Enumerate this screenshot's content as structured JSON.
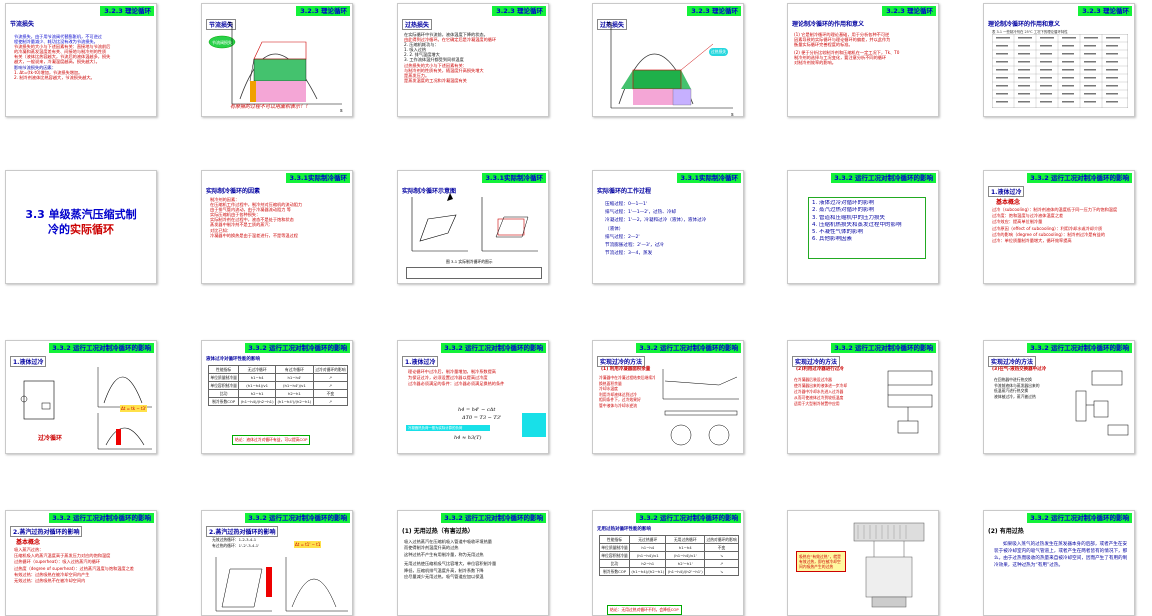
{
  "tiles": [
    {
      "id": 1,
      "header": "3.2.3 理论循环",
      "title": "节流损失",
      "lines": [
        "节流损失，由于用节流阀代替膨胀机，不可逆过",
        "程使制冷量减少、耗功比没有改为节流损失。",
        "节流损失的大小与下述因素有关：直接地与节流前后",
        "的冷凝和蒸发温度差有关、间接地与制冷剂的性质",
        "有关（液体比热容越大，节流后的液体温越多，损失",
        "越大，一般说来，冷凝温度越高，损失越大）。",
        "影响节流损失的因素：",
        "1. Δt=(tk-t0)增加，节流损失增加。",
        "2. 制冷剂液体比热容越大，节流损失越大。"
      ]
    },
    {
      "id": 2,
      "header": "3.2.3 理论循环",
      "title": "节流损失",
      "bubble": "节流阀损失",
      "footer": "有摩擦的过程不可以用面积表示！！"
    },
    {
      "id": 3,
      "header": "3.2.3 理论循环",
      "title": "过热损失",
      "lines": [
        "在实际循环中节流前，液体温度下降的状态。",
        "由此得到过冷循环。在它确定后是冷凝温度的循环",
        "2. 压缩机耗功与：",
        "1. 吸入过热",
        "2. 2. 排气温度增大",
        "3. 工作流体温升都受到同样温度",
        "过热损失的大小与下述因素有关：",
        "与制冷剂的性质有关，随温度升高损失增大",
        "是蒸发压力。",
        "是蒸发温度的工况和冷凝温度有关"
      ]
    },
    {
      "id": 4,
      "header": "3.2.3 理论循环",
      "title": "过热损失",
      "bubble": "过热损失"
    },
    {
      "id": 5,
      "header": "3.2.3 理论循环",
      "title": "理论制冷循环的作用和意义",
      "lines": [
        "(1) 它是制冷循环的理论基础，用于分析各种不可逆",
        "因素导致的实际循环与理论循环的偏差，并以此作为",
        "衡量实际循环完善程度的标准。",
        "(2) 便于分析比较制冷剂和压缩机在一定工况下，Tk、T0",
        "制冷剂的选择与工况变化，要注意分析不同的循环",
        "对制冷剂效率的影响。"
      ]
    },
    {
      "id": 6,
      "header": "3.2.3 理论循环",
      "title": "理论制冷循环的作用和意义",
      "table_caption": "表 3-1 一些制冷剂在 25℃ 工况下的理论循环特性"
    },
    {
      "id": 7,
      "title_main": "3.3 单级蒸汽压缩式制",
      "title_tail_a": "冷的",
      "title_tail_red": "实际循环"
    },
    {
      "id": 8,
      "header": "3.3.1实际制冷循环",
      "title": "实际制冷循环的因素",
      "lines": [
        "制冷剂的因素：",
        "在压缩机工作过程中，制冷剂对压缩机的流动阻力",
        "由于排气管内流动，由于冷凝器流动阻力 等",
        "实际压缩机由于各种损失：",
        "实际制冷剂在过程中，液态不是处于饱和状态",
        "蒸发器中制冷剂不是工质的蒸汽：",
        "对比已知：",
        "冷凝器中的换热是由于温差进行，不是等温过程"
      ]
    },
    {
      "id": 9,
      "header": "3.3.1实际制冷循环",
      "title": "实际制冷循环示意图",
      "caption": "图 3-1 实际制冷循环的图示"
    },
    {
      "id": 10,
      "header": "3.3.1实际制冷循环",
      "title": "实际循环的工作过程",
      "lines": [
        "压缩过程：0—1—1'",
        "排气过程：1'—1—2'，过热、冷却",
        "冷凝过程：1'—2，冷凝和过冷（液体），液体过冷",
        "（液体）",
        "排气过程：2—2'",
        "节流膨胀过程：2'—3'，过冷",
        "节流过程：3—4，蒸发"
      ]
    },
    {
      "id": 11,
      "header": "3.3.2 运行工况对制冷循环的影响",
      "items": [
        "1. 液体过冷对循环的影响",
        "2. 蒸汽过热对循环的影响",
        "3. 管道和压缩机中的压力损失",
        "4. 压缩机热损失和蒸发过程中的影响",
        "5. 不凝性气体的影响",
        "6. 其他影响因素"
      ]
    },
    {
      "id": 12,
      "header": "3.3.2 运行工况对制冷循环的影响",
      "title": "1.液体过冷",
      "sub": "基本概念",
      "lines": [
        "过冷（subcooling）：制冷剂液体的温度低于同一压力下的饱和温度",
        "过冷度：饱和温度与过冷液体温度之差",
        "过冷效应：提高单位制冷量",
        "过冷原因（effect of subcooling）：利用冷却水或冷却介质",
        "过冷的影响（degree of subcooling）：制冷剂过冷是有益的",
        "过冷：单位质量制冷量增大，循环效率提高"
      ]
    },
    {
      "id": 13,
      "header": "3.3.2 运行工况对制冷循环的影响",
      "title": "1.液体过冷",
      "caption": "过冷循环",
      "formula": "Δt = tk − t3'"
    },
    {
      "id": 14,
      "header": "3.3.2 运行工况对制冷循环的影响",
      "title": "液体过冷对循环性能的影响",
      "table_head": [
        "性能指标",
        "无过冷循环",
        "有过冷循环",
        "过冷对循环的影响"
      ],
      "table_rows": [
        [
          "单位质量制冷量",
          "h1−h4",
          "h1−h4'",
          "↗"
        ],
        [
          "单位容积制冷量",
          "(h1−h4)/v1",
          "(h1−h4')/v1",
          "↗"
        ],
        [
          "比功",
          "h2−h1",
          "h2−h1",
          "不变"
        ],
        [
          "制冷系数COP",
          "(h1−h4)/(h2−h1)",
          "(h1−h4')/(h2−h1)",
          "↗"
        ]
      ],
      "note": "结论：液体过冷对循环有益，可以提高COP"
    },
    {
      "id": 15,
      "header": "3.3.2 运行工况对制冷循环的影响",
      "title": "1.液体过冷",
      "lines": [
        "理论循环中过冷后，制冷量增加，制冷系数提高",
        "为保证过冷，必须设置过冷器以提高过冷度",
        "过冷器必须满足的条件：过冷器必须满足换热的条件"
      ],
      "formula1": "h4 = h4' − cΔt",
      "formula2": "ΔT0 = T3 − T3'",
      "formula3": "h4 ≈ h3(T)",
      "note": "冷凝器热负荷一般为实际计算的负荷"
    },
    {
      "id": 16,
      "header": "3.3.2 运行工况对制冷循环的影响",
      "title": "实现过冷的方法",
      "sub": "(1) 利用冷凝器面积余量",
      "lines": [
        "冷凝器中在冷凝过程结束后继续冷却",
        "换热面积余量",
        "冷却水温度",
        "利用冷却液体达到过冷",
        "相同条件下，过冷效果好",
        "管中液体与冷却水逆流"
      ]
    },
    {
      "id": 17,
      "header": "3.3.2 运行工况对制冷循环的影响",
      "title": "实现过冷的方法",
      "sub": "(2)利用过冷器进行过冷",
      "lines": [
        "在冷凝器后装设过冷器",
        "使冷凝器出来的液体进一步冷却",
        "过冷器中冷却水先进入过冷器",
        "从而可使液体过冷到较低温度",
        "适用于大型制冷装置中应用"
      ]
    },
    {
      "id": 18,
      "header": "3.3.2 运行工况对制冷循环的影响",
      "title": "实现过冷的方法",
      "sub": "(3)在气-液热交换器中过冷",
      "lines": [
        "在回热器中进行热交换",
        "节流前液体与蒸发器出来的",
        "低温蒸汽进行热交换",
        "液体被过冷，蒸汽被过热"
      ]
    },
    {
      "id": 19,
      "header": "3.3.2 运行工况对制冷循环的影响",
      "title": "2.蒸汽过热对循环的影响",
      "sub": "基本概念",
      "lines": [
        "吸入蒸汽过热：",
        "压缩机吸入的蒸汽温度高于蒸发压力对应的饱和温度",
        "过热循环（superheat）：吸入过热蒸汽的循环",
        "过热度（degree of superheat）：过热蒸汽温度与饱和温度之差",
        "有效过热：过热吸热在被冷却空间内产生",
        "无效过热：过热吸热不在被冷却空间内"
      ]
    },
    {
      "id": 20,
      "header": "3.3.2 运行工况对制冷循环的影响",
      "title": "2.蒸汽过热对循环的影响",
      "lines": [
        "无效过热循环：1-2-3-4-1",
        "有过热的循环：1'-2'-3-4-1'"
      ],
      "formula": "Δt = t1' − t1"
    },
    {
      "id": 21,
      "header": "3.3.2 运行工况对制冷循环的影响",
      "title": "(1) 无用过热（有害过热）",
      "lines": [
        "吸入过热蒸汽在压缩机吸入管道中吸收环境热量",
        "而使得制冷剂温度升高的过热",
        "这种过热不产生有用制冷量，称为无用过热",
        "无用过热使压缩机吸气比容增大，单位容积制冷量",
        "降低，压缩机排气温度升高，制冷系数下降",
        "应尽量减少无用过热，吸气管道应加以保温"
      ]
    },
    {
      "id": 22,
      "header": "3.3.2 运行工况对制冷循环的影响",
      "title": "无用过热对循环性能的影响",
      "table_head": [
        "性能指标",
        "无过热循环",
        "无用过热循环",
        "过热对循环的影响"
      ],
      "table_rows": [
        [
          "单位质量制冷量",
          "h1−h4",
          "h1−h4",
          "不变"
        ],
        [
          "单位容积制冷量",
          "(h1−h4)/v1",
          "(h1−h4)/v1'",
          "↘"
        ],
        [
          "比功",
          "h2−h1",
          "h2'−h1'",
          "↗"
        ],
        [
          "制冷系数COP",
          "(h1−h4)/(h2−h1)",
          "(h1−h4)/(h2'−h1')",
          "↘"
        ]
      ],
      "note": "结论：无用过热对循环不利，会降低COP"
    },
    {
      "id": 23,
      "bubble_text": "吸热在“有效过热”，就是有效过热，即在被冷却空间内吸热产生的过热"
    },
    {
      "id": 24,
      "header": "3.3.2 运行工况对制冷循环的影响",
      "title": "(2) 有用过热",
      "para": "如果吸入蒸气的过热发生在蒸发器本身的后部，或者产生在安装于被冷却室内的吸气管道上，或者产生在两者皆有的情况下，那么，由于过热而吸收的热量来自被冷却空间，因而产生了有用的制冷效果，这种过热为“有用”过热。"
    }
  ]
}
